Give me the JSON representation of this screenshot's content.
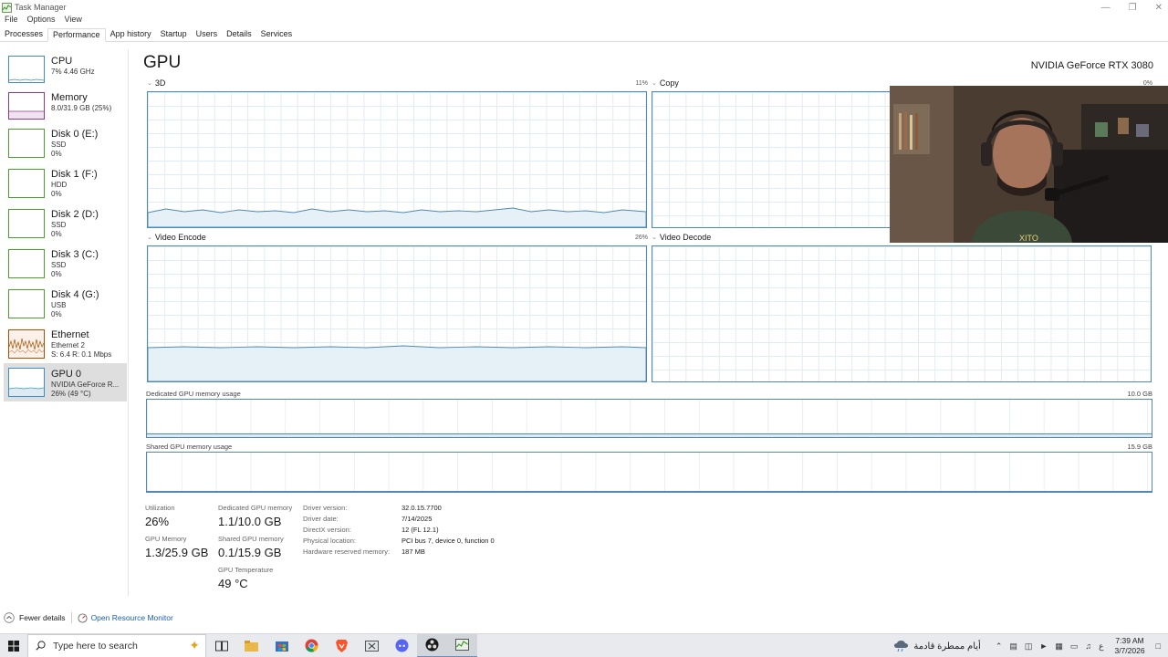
{
  "window": {
    "title": "Task Manager"
  },
  "menu": [
    "File",
    "Options",
    "View"
  ],
  "tabs": [
    "Processes",
    "Performance",
    "App history",
    "Startup",
    "Users",
    "Details",
    "Services"
  ],
  "sidebar": {
    "items": [
      {
        "title": "CPU",
        "lines": [
          "7% 4.46 GHz"
        ]
      },
      {
        "title": "Memory",
        "lines": [
          "8.0/31.9 GB (25%)"
        ]
      },
      {
        "title": "Disk 0 (E:)",
        "lines": [
          "SSD",
          "0%"
        ]
      },
      {
        "title": "Disk 1 (F:)",
        "lines": [
          "HDD",
          "0%"
        ]
      },
      {
        "title": "Disk 2 (D:)",
        "lines": [
          "SSD",
          "0%"
        ]
      },
      {
        "title": "Disk 3 (C:)",
        "lines": [
          "SSD",
          "0%"
        ]
      },
      {
        "title": "Disk 4 (G:)",
        "lines": [
          "USB",
          "0%"
        ]
      },
      {
        "title": "Ethernet",
        "lines": [
          "Ethernet 2",
          "S: 6.4 R: 0.1 Mbps"
        ]
      },
      {
        "title": "GPU 0",
        "lines": [
          "NVIDIA GeForce R...",
          "26% (49 °C)"
        ]
      }
    ],
    "colors": {
      "cpu": "#3c8fc0",
      "memory": "#8b3a8b",
      "disk": "#4aa02c",
      "ethernet": "#a74f01",
      "gpu": "#3c8fc0"
    }
  },
  "main": {
    "heading": "GPU",
    "model": "NVIDIA GeForce RTX 3080",
    "engines": [
      {
        "name": "3D",
        "percent": "11%"
      },
      {
        "name": "Copy",
        "percent": "0%"
      },
      {
        "name": "Video Encode",
        "percent": "26%"
      },
      {
        "name": "Video Decode",
        "percent": ""
      }
    ],
    "dedicated": {
      "label": "Dedicated GPU memory usage",
      "max": "10.0 GB"
    },
    "shared": {
      "label": "Shared GPU memory usage",
      "max": "15.9 GB"
    },
    "stats": {
      "utilization": {
        "label": "Utilization",
        "value": "26%"
      },
      "dedicated_mem": {
        "label": "Dedicated GPU memory",
        "value": "1.1/10.0 GB"
      },
      "gpu_memory": {
        "label": "GPU Memory",
        "value": "1.3/25.9 GB"
      },
      "shared_mem": {
        "label": "Shared GPU memory",
        "value": "0.1/15.9 GB"
      },
      "temperature": {
        "label": "GPU Temperature",
        "value": "49 °C"
      }
    },
    "info": [
      {
        "label": "Driver version:",
        "value": "32.0.15.7700"
      },
      {
        "label": "Driver date:",
        "value": "7/14/2025"
      },
      {
        "label": "DirectX version:",
        "value": "12 (FL 12.1)"
      },
      {
        "label": "Physical location:",
        "value": "PCI bus 7, device 0, function 0"
      },
      {
        "label": "Hardware reserved memory:",
        "value": "187 MB"
      }
    ]
  },
  "footer": {
    "fewer_details": "Fewer details",
    "resource_monitor": "Open Resource Monitor"
  },
  "taskbar": {
    "search_placeholder": "Type here to search",
    "weather": "أيام ممطرة قادمة",
    "lang": "ع",
    "time": "7:39 AM",
    "date": "3/7/2026"
  },
  "graph_color": "#4e8ab4"
}
